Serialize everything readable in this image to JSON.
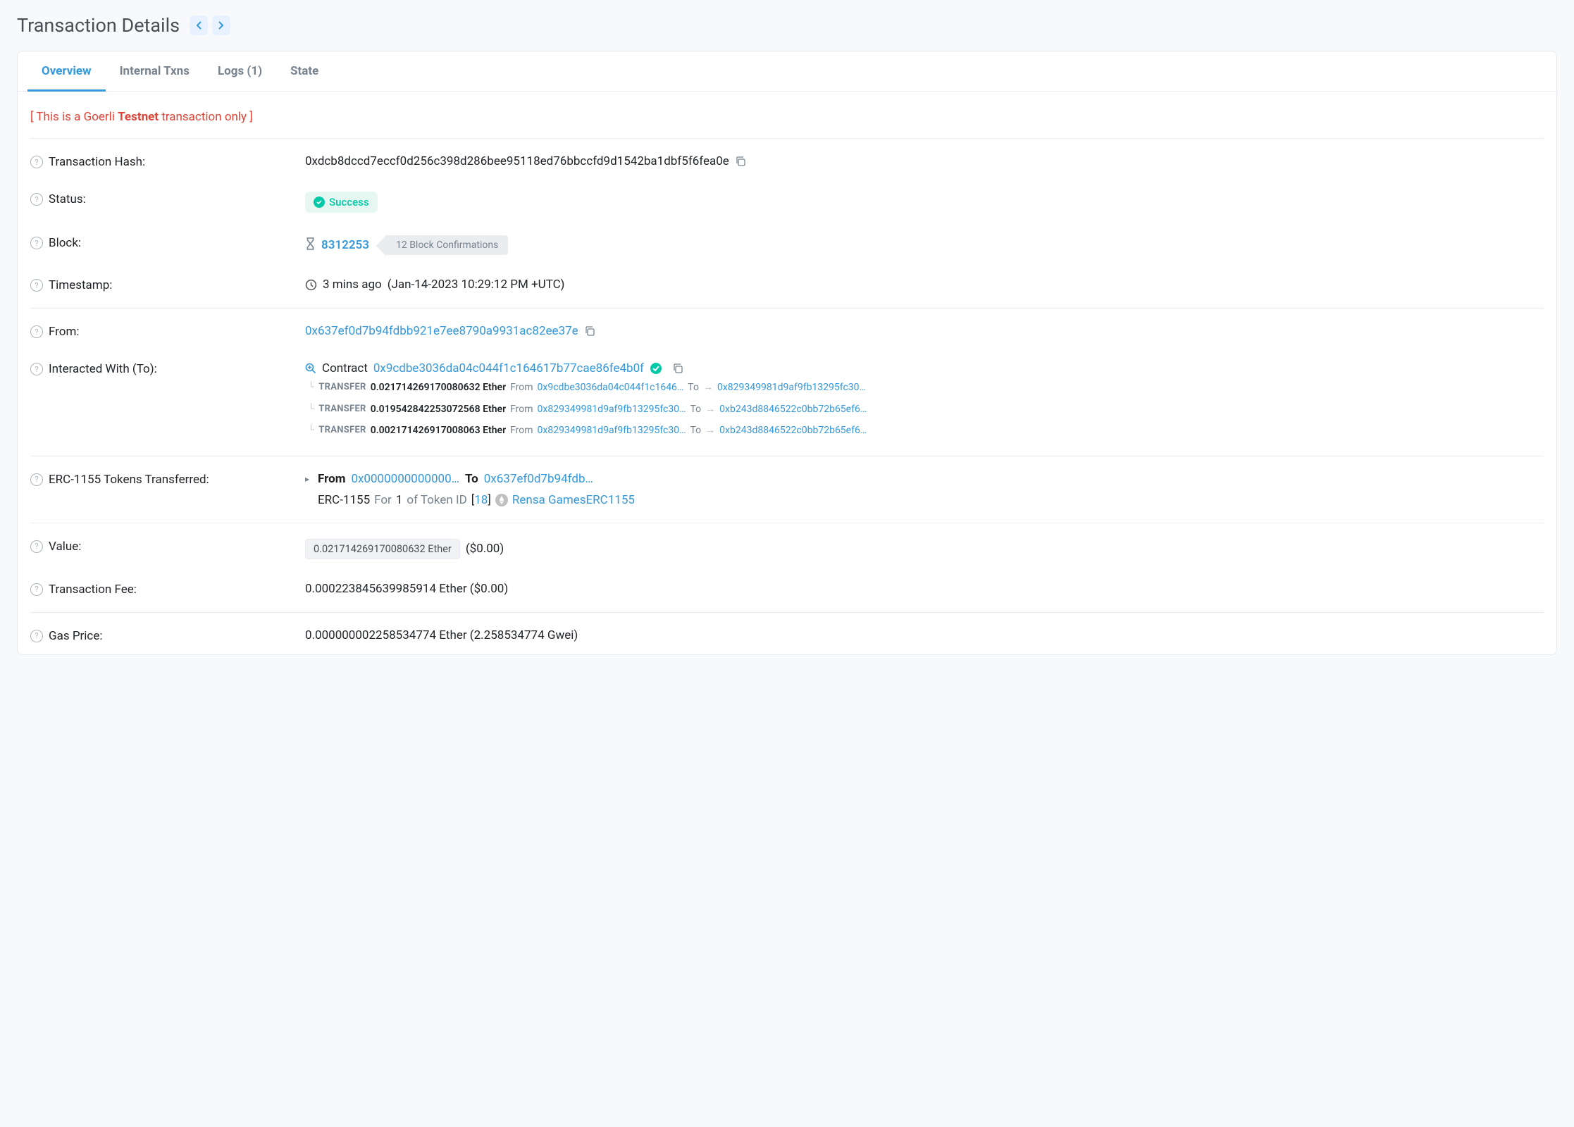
{
  "header": {
    "title": "Transaction Details"
  },
  "tabs": {
    "overview": "Overview",
    "internal": "Internal Txns",
    "logs": "Logs (1)",
    "state": "State"
  },
  "banner": {
    "prefix": "[ This is a Goerli ",
    "bold": "Testnet",
    "suffix": " transaction only ]"
  },
  "labels": {
    "txhash": "Transaction Hash:",
    "status": "Status:",
    "block": "Block:",
    "timestamp": "Timestamp:",
    "from": "From:",
    "to": "Interacted With (To):",
    "erc1155": "ERC-1155 Tokens Transferred:",
    "value": "Value:",
    "txfee": "Transaction Fee:",
    "gasprice": "Gas Price:"
  },
  "tx": {
    "hash": "0xdcb8dccd7eccf0d256c398d286bee95118ed76bbccfd9d1542ba1dbf5f6fea0e",
    "status": "Success",
    "block": "8312253",
    "confirmations": "12 Block Confirmations",
    "timestampAgo": "3 mins ago",
    "timestampFull": "(Jan-14-2023 10:29:12 PM +UTC)",
    "from": "0x637ef0d7b94fdbb921e7ee8790a9931ac82ee37e",
    "to": {
      "contractLabel": "Contract",
      "address": "0x9cdbe3036da04c044f1c164617b77cae86fe4b0f"
    },
    "transfers": [
      {
        "amount": "0.021714269170080632 Ether",
        "from": "0x9cdbe3036da04c044f1c1646…",
        "to": "0x829349981d9af9fb13295fc30…"
      },
      {
        "amount": "0.019542842253072568 Ether",
        "from": "0x829349981d9af9fb13295fc30…",
        "to": "0xb243d8846522c0bb72b65ef6…"
      },
      {
        "amount": "0.002171426917008063 Ether",
        "from": "0x829349981d9af9fb13295fc30…",
        "to": "0xb243d8846522c0bb72b65ef6…"
      }
    ],
    "transferLabels": {
      "action": "TRANSFER",
      "from": "From",
      "to": "To"
    },
    "erc1155": {
      "fromLabel": "From",
      "fromAddr": "0x0000000000000…",
      "toLabel": "To",
      "toAddr": "0x637ef0d7b94fdb…",
      "line2Prefix": "ERC-1155",
      "line2For": "For",
      "line2Qty": "1",
      "line2OfToken": "of Token ID",
      "tokenId": "18",
      "tokenName": "Rensa GamesERC1155"
    },
    "value": "0.021714269170080632 Ether",
    "valueUsd": "($0.00)",
    "txfee": "0.000223845639985914 Ether ($0.00)",
    "gasprice": "0.000000002258534774 Ether (2.258534774 Gwei)"
  }
}
